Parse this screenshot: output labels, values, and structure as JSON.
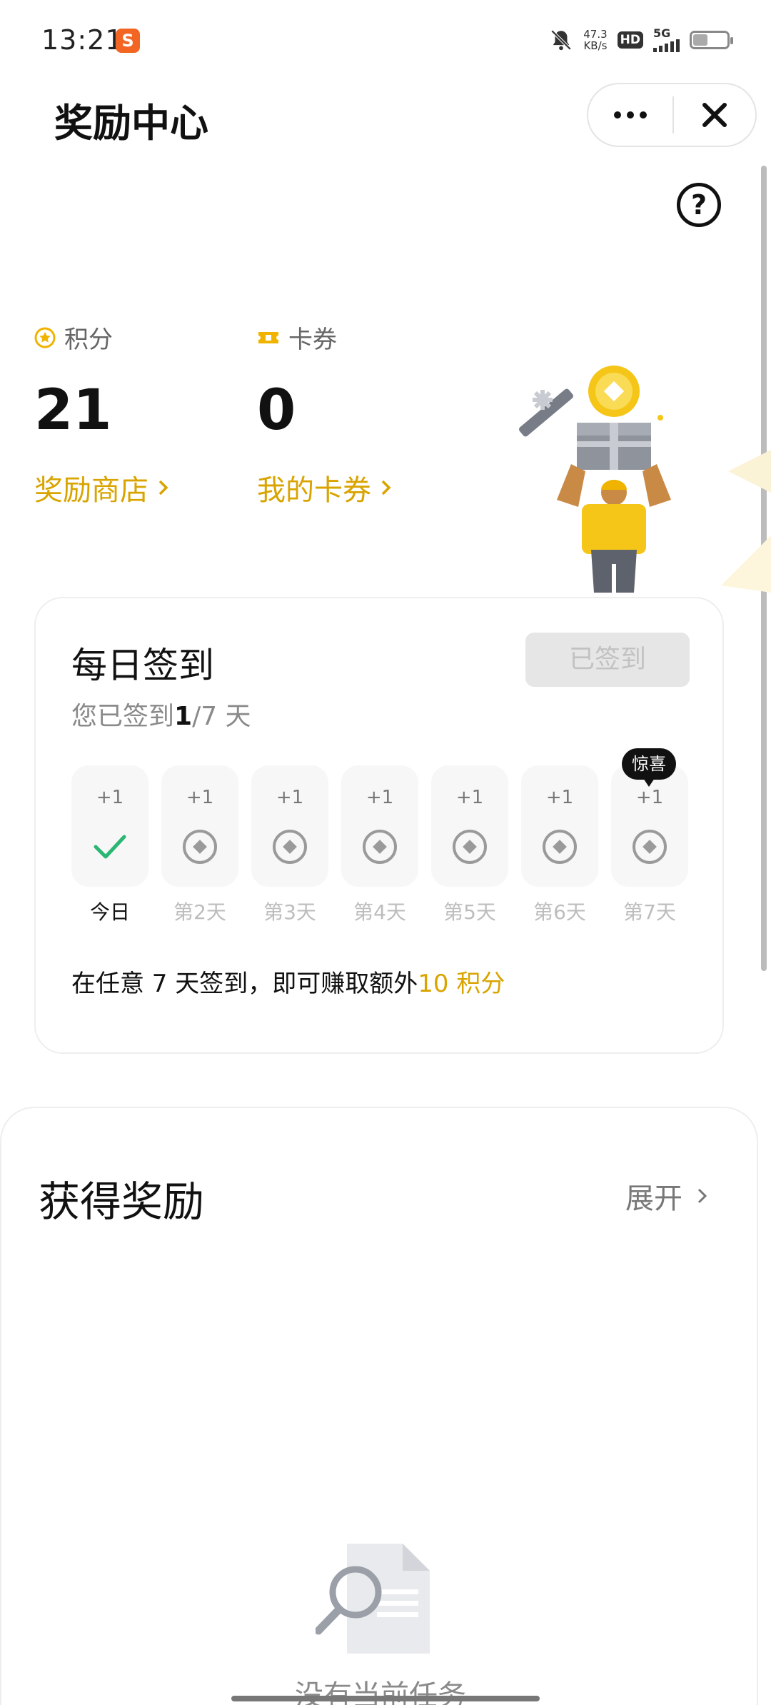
{
  "status_bar": {
    "time": "13:21",
    "app_badge": "S",
    "net_speed": "47.3",
    "net_unit": "KB/s",
    "hd": "HD",
    "network": "5G"
  },
  "header": {
    "title": "奖励中心"
  },
  "stats": {
    "points_label": "积分",
    "points_value": "21",
    "points_link": "奖励商店",
    "coupons_label": "卡券",
    "coupons_value": "0",
    "coupons_link": "我的卡券"
  },
  "signin": {
    "title": "每日签到",
    "button_label": "已签到",
    "progress_prefix": "您已签到",
    "progress_count": "1",
    "progress_suffix": "/7 天",
    "days": [
      {
        "plus": "+1",
        "label": "今日",
        "state": "done"
      },
      {
        "plus": "+1",
        "label": "第2天",
        "state": "pending"
      },
      {
        "plus": "+1",
        "label": "第3天",
        "state": "pending"
      },
      {
        "plus": "+1",
        "label": "第4天",
        "state": "pending"
      },
      {
        "plus": "+1",
        "label": "第5天",
        "state": "pending"
      },
      {
        "plus": "+1",
        "label": "第6天",
        "state": "pending"
      },
      {
        "plus": "+1",
        "label": "第7天",
        "state": "pending"
      }
    ],
    "surprise_label": "惊喜",
    "footer_text": "在任意 7 天签到，即可赚取额外",
    "footer_highlight": "10 积分"
  },
  "rewards": {
    "title": "获得奖励",
    "expand_label": "展开",
    "empty_text": "没有当前任务"
  },
  "colors": {
    "accent": "#d9a400",
    "check": "#2bb673",
    "text": "#111111",
    "muted": "#8a8a8a"
  }
}
